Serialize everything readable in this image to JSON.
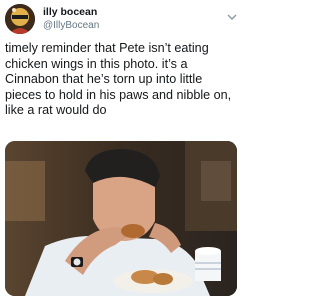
{
  "tweet": {
    "display_name": "illy bocean",
    "handle": "@IllyBocean",
    "text": "timely reminder that Pete isn’t eating chicken wings in this photo. it’s a Cinnabon that he’s torn up into little pieces to hold in his paws and nibble on, like a rat would do"
  },
  "icons": {
    "avatar": "avatar-image",
    "menu": "chevron-down-icon"
  },
  "colors": {
    "text": "#14171a",
    "secondary": "#657786"
  }
}
